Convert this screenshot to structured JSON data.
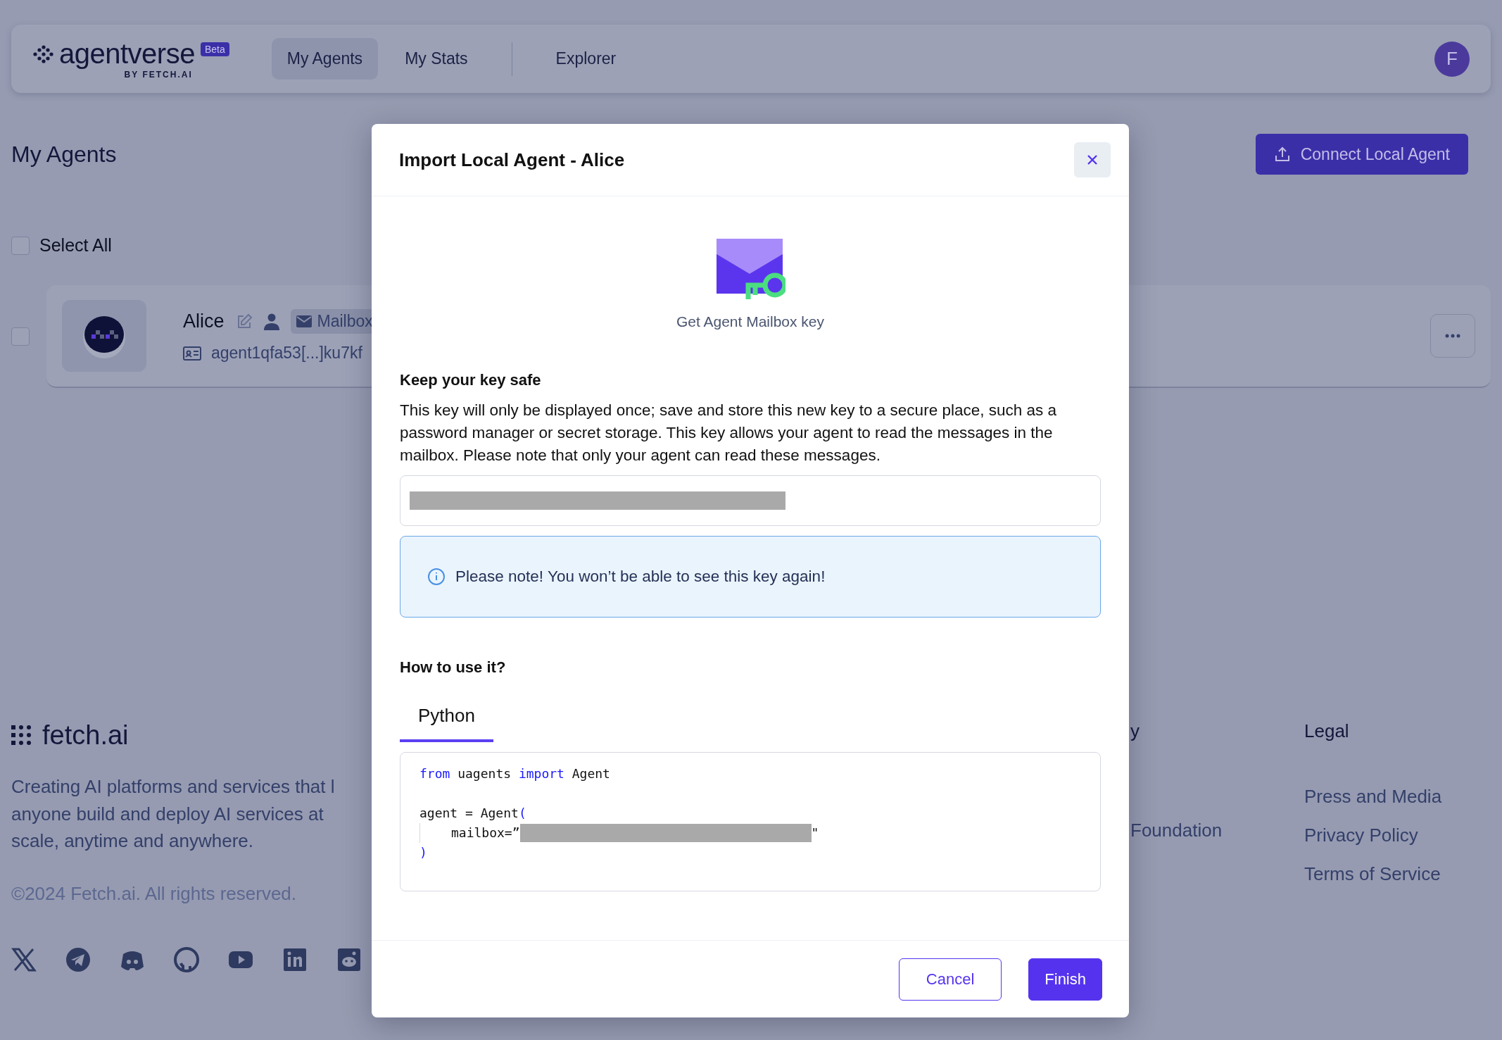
{
  "header": {
    "logo": {
      "name": "agentverse",
      "badge": "Beta",
      "byline": "BY FETCH.AI"
    },
    "nav": [
      {
        "label": "My Agents",
        "selected": true
      },
      {
        "label": "My Stats",
        "selected": false
      },
      {
        "label": "Explorer",
        "selected": false
      }
    ],
    "avatar": "F"
  },
  "page": {
    "title": "My Agents",
    "connect_button": "Connect Local Agent",
    "select_all": {
      "label": "Select All",
      "checked": false
    },
    "agents": [
      {
        "name": "Alice",
        "badge": "Mailbox",
        "address": "agent1qfa53[...]ku7kf",
        "checked": false
      }
    ]
  },
  "footer": {
    "logo": "fetch.ai",
    "tagline": "Creating AI platforms and services that l\nanyone build and deploy AI services at\nscale, anytime and anywhere.",
    "copyright": "©2024 Fetch.ai. All rights reserved.",
    "middle_column": {
      "heading": "y",
      "links": [
        "Foundation"
      ]
    },
    "legal": {
      "heading": "Legal",
      "links": [
        "Press and Media",
        "Privacy Policy",
        "Terms of Service"
      ]
    }
  },
  "modal": {
    "title": "Import Local Agent - Alice",
    "caption": "Get Agent Mailbox key",
    "section_title": "Keep your key safe",
    "description": "This key will only be displayed once; save and store this new key to a secure place, such as a password manager or secret storage. This key allows your agent to read the messages in the mailbox. Please note that only your agent can read these messages.",
    "notice": "Please note! You won’t be able to see this key again!",
    "usage_title": "How to use it?",
    "tabs": [
      {
        "label": "Python",
        "selected": true
      }
    ],
    "code": [
      {
        "kind": "code",
        "tokens": [
          {
            "kind": "keyword",
            "text": "from"
          },
          {
            "kind": "plain",
            "text": " uagents "
          },
          {
            "kind": "keyword",
            "text": "import"
          },
          {
            "kind": "plain",
            "text": " Agent"
          }
        ]
      },
      {
        "kind": "blank"
      },
      {
        "kind": "code",
        "tokens": [
          {
            "kind": "plain",
            "text": "agent = Agent"
          },
          {
            "kind": "punct",
            "text": "("
          }
        ]
      },
      {
        "kind": "indented",
        "tokens": [
          {
            "kind": "plain",
            "text": "mailbox=”"
          },
          {
            "kind": "redacted"
          },
          {
            "kind": "plain",
            "text": "\""
          }
        ]
      },
      {
        "kind": "code",
        "tokens": [
          {
            "kind": "punct",
            "text": ")"
          }
        ]
      }
    ],
    "buttons": [
      {
        "label": "Cancel",
        "kind": "secondary"
      },
      {
        "label": "Finish",
        "kind": "primary"
      }
    ]
  }
}
